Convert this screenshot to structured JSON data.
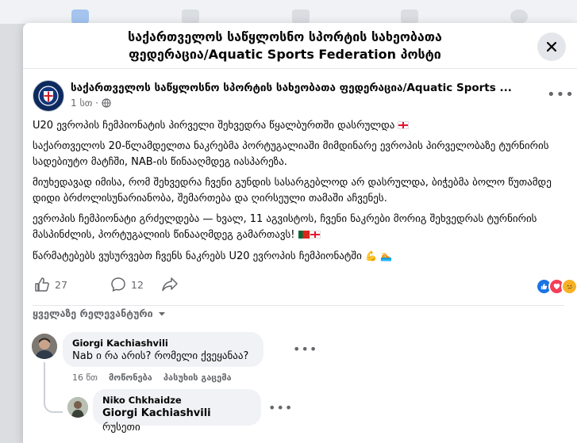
{
  "modal": {
    "title_line1": "საქართველოს საწყლოსნო სპორტის სახეობათა",
    "title_line2": "ფედერაცია/Aquatic Sports Federation პოსტი"
  },
  "post": {
    "page_name": "საქართველოს საწყლოსნო სპორტის სახეობათა ფედერაცია/Aquatic Sports ...",
    "time": "1 სთ ·",
    "paragraphs": {
      "p1": "U20 ევროპის ჩემპიონატის პირველი შეხვედრა წყალბურთში დასრულდა",
      "p2": "საქართველოს 20-წლამდელთა ნაკრებმა პორტუგალიაში მიმდინარე ევროპის პირველობაზე ტურნირის სადებიუტო მატჩში,  NAB-ის წინააღმდეგ იასპარეზა.",
      "p3": "მიუხედავად იმისა, რომ შეხვედრა ჩვენი გუნდის სასარგებლოდ არ დასრულდა, ბიჭებმა ბოლო წუთამდე დიდი ბრძოლისუნარიანობა, შემართება და ღირსეული თამაში აჩვენეს.",
      "p4": "ევროპის ჩემპიონატი გრძელდება — ხვალ, 11 აგვისტოს, ჩვენი ნაკრები მორიგ შეხვედრას ტურნირის მასპინძლის, პორტუგალიის წინააღმდეგ გამართავს!",
      "p5": "წარმატებებს ვუსურვებთ ჩვენს ნაკრებს U20 ევროპის ჩემპიონატში"
    },
    "likes": "27",
    "comments": "12"
  },
  "comments_section": {
    "sort_label": "ყველაზე რელევანტური"
  },
  "comments": {
    "c1": {
      "author": "Giorgi Kachiashvili",
      "text": "Nab ი რა არის? რომელი ქვეყანაა?",
      "time": "16 წთ",
      "like": "მოწონება",
      "reply": "პასუხის გაცემა"
    },
    "c2": {
      "author": "Niko Chkhaidze",
      "mention": "Giorgi Kachiashvili",
      "text": "რუსეთი"
    }
  },
  "colors": {
    "accent": "#1b74e4",
    "love": "#f33e58",
    "bg": "#dcdde1"
  }
}
